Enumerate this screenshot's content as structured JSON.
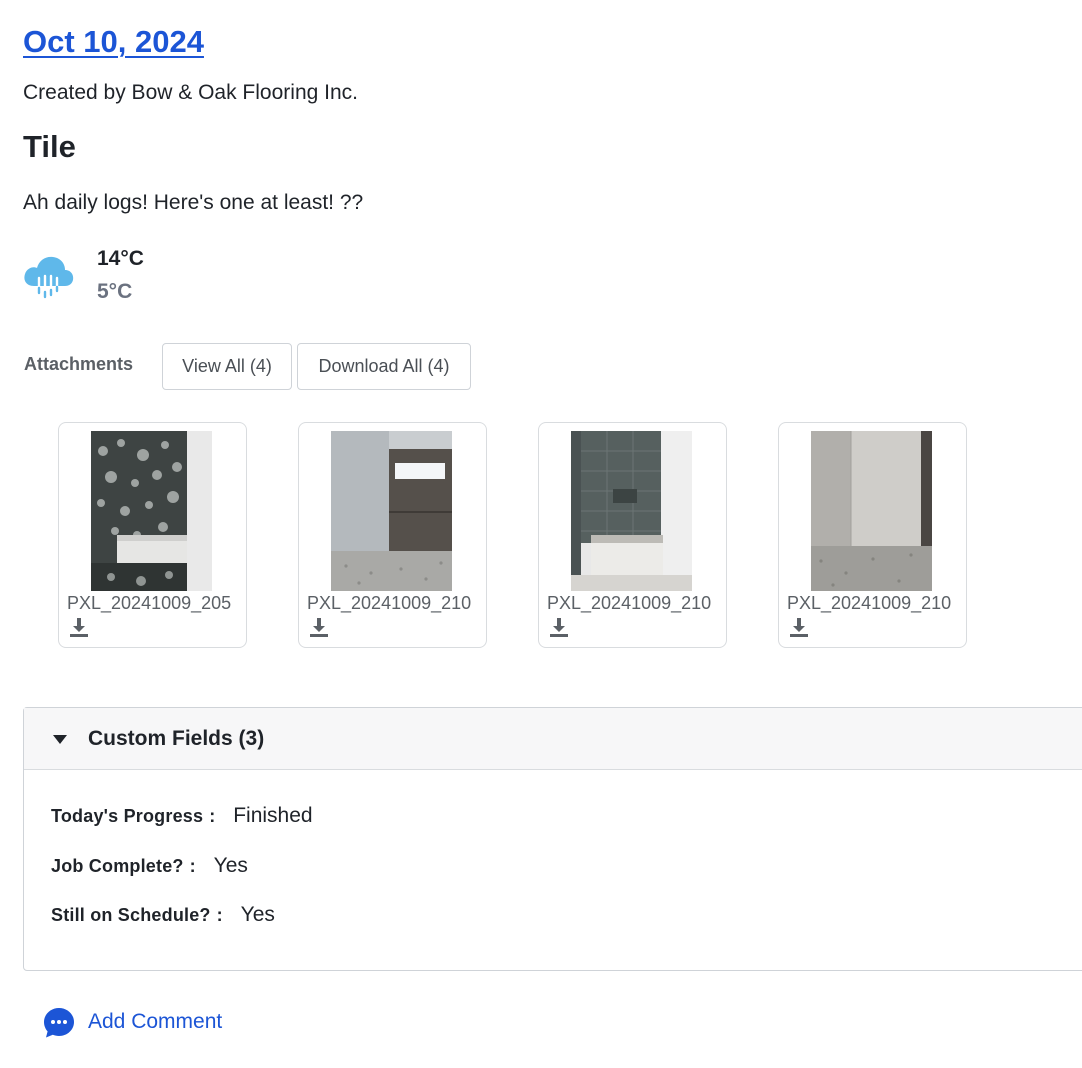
{
  "log": {
    "date": "Oct 10, 2024",
    "created_by": "Created by Bow & Oak Flooring Inc.",
    "title": "Tile",
    "notes": "Ah daily logs! Here's one at least! ??"
  },
  "weather": {
    "icon": "rain-cloud-icon",
    "high": "14°C",
    "low": "5°C"
  },
  "attachments": {
    "label": "Attachments",
    "view_all": "View All (4)",
    "download_all": "Download All (4)",
    "files": [
      {
        "name": "PXL_20241009_205",
        "icon": "download-icon"
      },
      {
        "name": "PXL_20241009_210",
        "icon": "download-icon"
      },
      {
        "name": "PXL_20241009_210",
        "icon": "download-icon"
      },
      {
        "name": "PXL_20241009_210",
        "icon": "download-icon"
      }
    ]
  },
  "custom_fields": {
    "title": "Custom Fields (3)",
    "fields": [
      {
        "label": "Today's Progress",
        "value": "Finished"
      },
      {
        "label": "Job Complete?",
        "value": "Yes"
      },
      {
        "label": "Still on Schedule?",
        "value": "Yes"
      }
    ]
  },
  "comment": {
    "label": "Add Comment",
    "icon": "chat-bubble-icon"
  },
  "colors": {
    "link": "#1c55d6",
    "weather": "#5fb8ea"
  }
}
